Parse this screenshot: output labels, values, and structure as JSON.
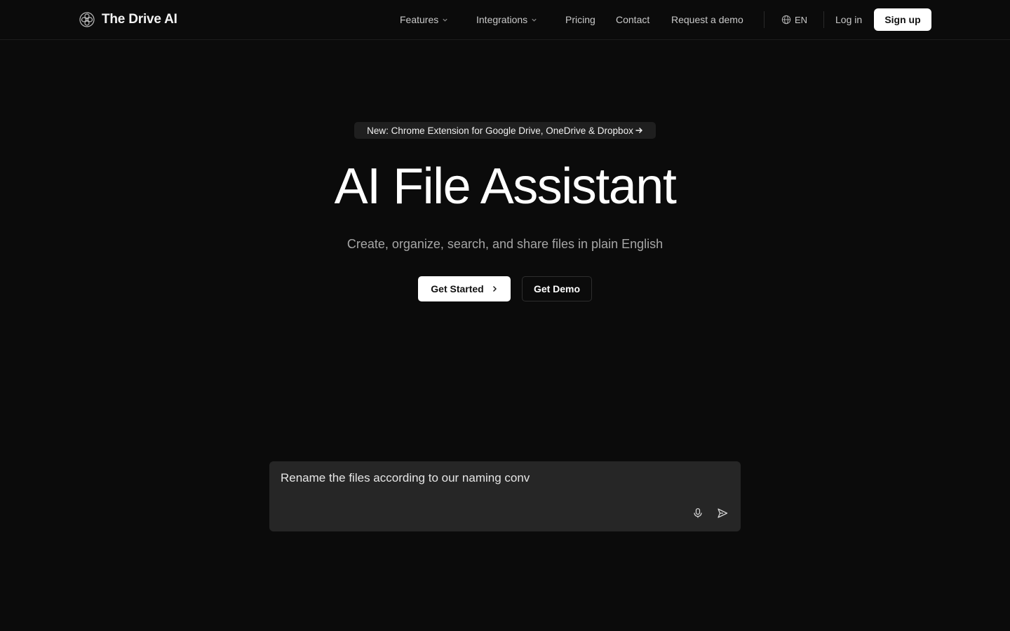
{
  "brand": {
    "name": "The Drive AI",
    "logo_icon": "brain-icon"
  },
  "nav": {
    "features": "Features",
    "integrations": "Integrations",
    "pricing": "Pricing",
    "contact": "Contact",
    "request_demo": "Request a demo",
    "language": "EN",
    "login": "Log in",
    "signup": "Sign up"
  },
  "hero": {
    "announcement": "New: Chrome Extension for Google Drive, OneDrive & Dropbox",
    "title": "AI File Assistant",
    "subtitle": "Create, organize, search, and share files in plain English",
    "cta_primary": "Get Started",
    "cta_secondary": "Get Demo"
  },
  "prompt": {
    "value": "Rename the files according to our naming conv",
    "mic_icon": "microphone-icon",
    "send_icon": "send-icon"
  },
  "colors": {
    "background": "#0b0b0b",
    "accent": "#ffffff",
    "prompt_box": "#262626"
  }
}
